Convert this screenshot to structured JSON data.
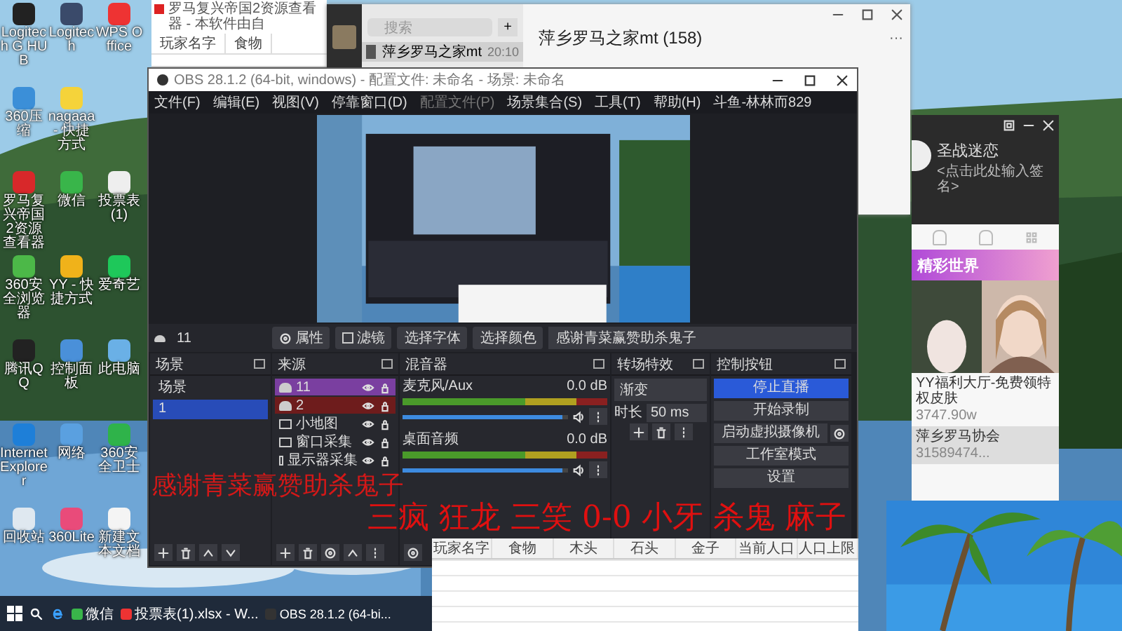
{
  "desktop_icons": [
    {
      "label": "Logitech G HUB",
      "kind": "g"
    },
    {
      "label": "Logitech",
      "kind": "user"
    },
    {
      "label": "WPS Office",
      "kind": "wps"
    },
    {
      "label": "360压缩",
      "kind": "zip"
    },
    {
      "label": "nagaaa - 快捷方式",
      "kind": "pac"
    },
    {
      "kind": "none"
    },
    {
      "label": "罗马复兴帝国2资源查看器",
      "kind": "rome"
    },
    {
      "label": "微信",
      "kind": "wechat"
    },
    {
      "label": "投票表(1)",
      "kind": "sheet"
    },
    {
      "label": "360安全浏览器",
      "kind": "browser"
    },
    {
      "label": "YY - 快捷方式",
      "kind": "yy"
    },
    {
      "label": "爱奇艺",
      "kind": "iqiyi"
    },
    {
      "label": "腾讯QQ",
      "kind": "qq"
    },
    {
      "label": "控制面板",
      "kind": "panel"
    },
    {
      "label": "此电脑",
      "kind": "pc"
    },
    {
      "label": "Internet Explorer",
      "kind": "ie"
    },
    {
      "label": "网络",
      "kind": "net"
    },
    {
      "label": "360安全卫士",
      "kind": "guard"
    },
    {
      "label": "回收站",
      "kind": "bin"
    },
    {
      "label": "360Lite",
      "kind": "tiles"
    },
    {
      "label": "新建文本文档",
      "kind": "doc"
    }
  ],
  "top_sheet": {
    "title": "罗马复兴帝国2资源查看器 - 本软件由自",
    "columns": [
      "玩家名字",
      "食物"
    ]
  },
  "wechat": {
    "search": {
      "placeholder": "搜索"
    },
    "add": "+",
    "chat": {
      "name": "萍乡罗马之家mt",
      "time": "20:10"
    },
    "title": "萍乡罗马之家mt (158)",
    "more": "···"
  },
  "obs": {
    "title": "OBS 28.1.2 (64-bit, windows) - 配置文件: 未命名 - 场景: 未命名",
    "menu": [
      {
        "label": "文件(F)",
        "disabled": false
      },
      {
        "label": "编辑(E)",
        "disabled": false
      },
      {
        "label": "视图(V)",
        "disabled": false
      },
      {
        "label": "停靠窗口(D)",
        "disabled": false
      },
      {
        "label": "配置文件(P)",
        "disabled": true
      },
      {
        "label": "场景集合(S)",
        "disabled": false
      },
      {
        "label": "工具(T)",
        "disabled": false
      },
      {
        "label": "帮助(H)",
        "disabled": false
      },
      {
        "label": "斗鱼-林林而829",
        "disabled": false
      }
    ],
    "source_bar": {
      "name": "11",
      "buttons": [
        {
          "label": "属性",
          "kind": "gear"
        },
        {
          "label": "滤镜",
          "kind": "filter"
        },
        {
          "label": "选择字体",
          "kind": "plain"
        },
        {
          "label": "选择颜色",
          "kind": "plain"
        }
      ],
      "text": "感谢青菜赢赞助杀鬼子"
    },
    "scenes": {
      "title": "场景",
      "items": [
        {
          "label": "场景",
          "selected": false
        },
        {
          "label": "1",
          "selected": true
        }
      ]
    },
    "sources": {
      "title": "来源",
      "items": [
        {
          "label": "11",
          "kind": "cloud",
          "color": "#7a3fa0"
        },
        {
          "label": "2",
          "kind": "cloud",
          "color": "#6e1c1c"
        },
        {
          "label": "小地图"
        },
        {
          "label": "窗口采集",
          "kind": "window"
        },
        {
          "label": "显示器采集",
          "kind": "monitor"
        }
      ]
    },
    "mixer": {
      "title": "混音器",
      "channels": [
        {
          "name": "麦克风/Aux",
          "reading": "0.0 dB",
          "level": 0.97
        },
        {
          "name": "桌面音频",
          "reading": "0.0 dB",
          "level": 0.97
        }
      ]
    },
    "transitions": {
      "title": "转场特效",
      "type": "渐变",
      "duration_label": "时长",
      "duration": "50 ms"
    },
    "controls": {
      "title": "控制按钮",
      "buttons": [
        {
          "label": "停止直播",
          "kind": "primary"
        },
        {
          "label": "开始录制",
          "kind": "normal"
        },
        {
          "label": "启动虚拟摄像机",
          "kind": "gear"
        },
        {
          "label": "工作室模式",
          "kind": "normal"
        },
        {
          "label": "设置",
          "kind": "normal"
        }
      ]
    }
  },
  "overlay": {
    "thanks": "感谢青菜赢赞助杀鬼子",
    "names": "三疯 狂龙 三笑 0-0 小牙 杀鬼 麻子"
  },
  "bottom_sheet": {
    "columns": [
      "玩家名字",
      "食物",
      "木头",
      "石头",
      "金子",
      "当前人口",
      "人口上限"
    ]
  },
  "yy": {
    "name": "圣战迷恋",
    "signature": "<点击此处输入签名>",
    "banner": "精彩世界",
    "list": [
      {
        "title": "YY福利大厅-免费领特权皮肤",
        "sub": "3747.90w"
      },
      {
        "title": "萍乡罗马协会",
        "sub": "31589474..."
      }
    ]
  },
  "taskbar": [
    {
      "label": "微信",
      "kind": "wechat"
    },
    {
      "label": "投票表(1).xlsx - W...",
      "kind": "wps"
    },
    {
      "label": "OBS 28.1.2 (64-bi...",
      "kind": "obs"
    }
  ]
}
